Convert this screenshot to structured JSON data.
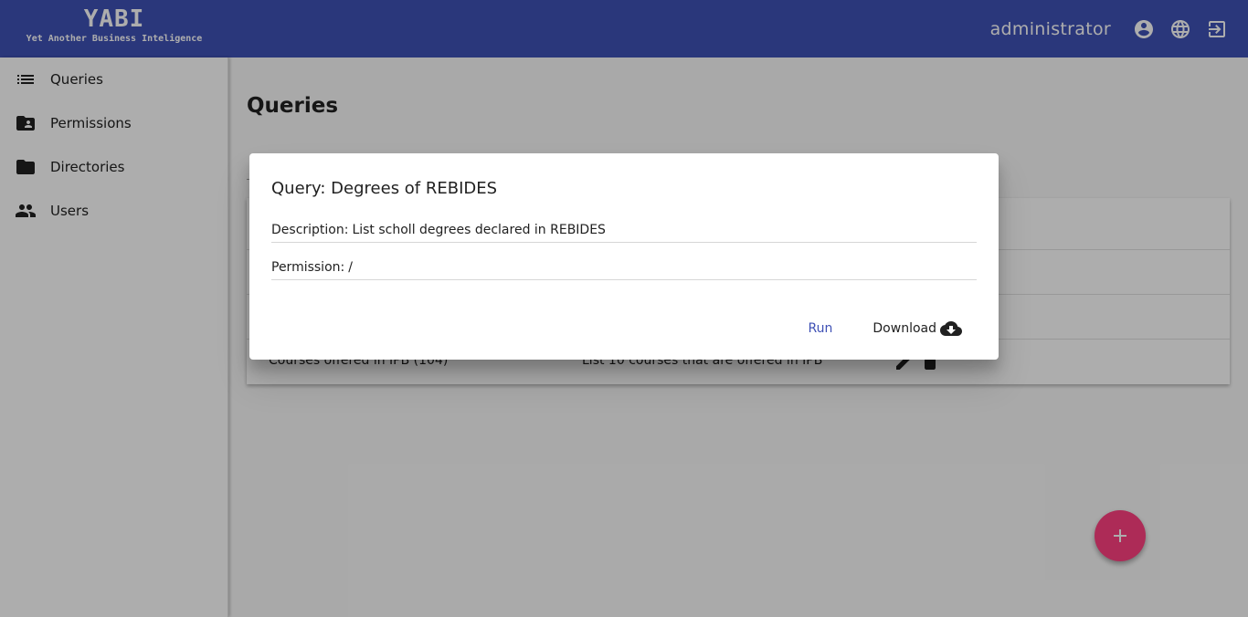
{
  "header": {
    "logo": "YABI",
    "tagline": "Yet Another Business Inteligence",
    "username": "administrator"
  },
  "sidebar": {
    "items": [
      {
        "label": "Queries",
        "icon": "list-icon"
      },
      {
        "label": "Permissions",
        "icon": "folder-shared-icon"
      },
      {
        "label": "Directories",
        "icon": "folder-icon"
      },
      {
        "label": "Users",
        "icon": "people-icon"
      }
    ]
  },
  "main": {
    "title": "Queries",
    "rows": [
      {
        "name": "Courses offered in IPB (104)",
        "description": "List 10 courses that are offered in IPB"
      }
    ]
  },
  "dialog": {
    "title": "Query: Degrees of REBIDES",
    "description_label": "Description:",
    "description_value": "List scholl degrees declared in REBIDES",
    "permission_label": "Permission:",
    "permission_value": "/",
    "run_label": "Run",
    "download_label": "Download"
  },
  "colors": {
    "primary": "#3f51b5",
    "accent": "#ff4081"
  }
}
